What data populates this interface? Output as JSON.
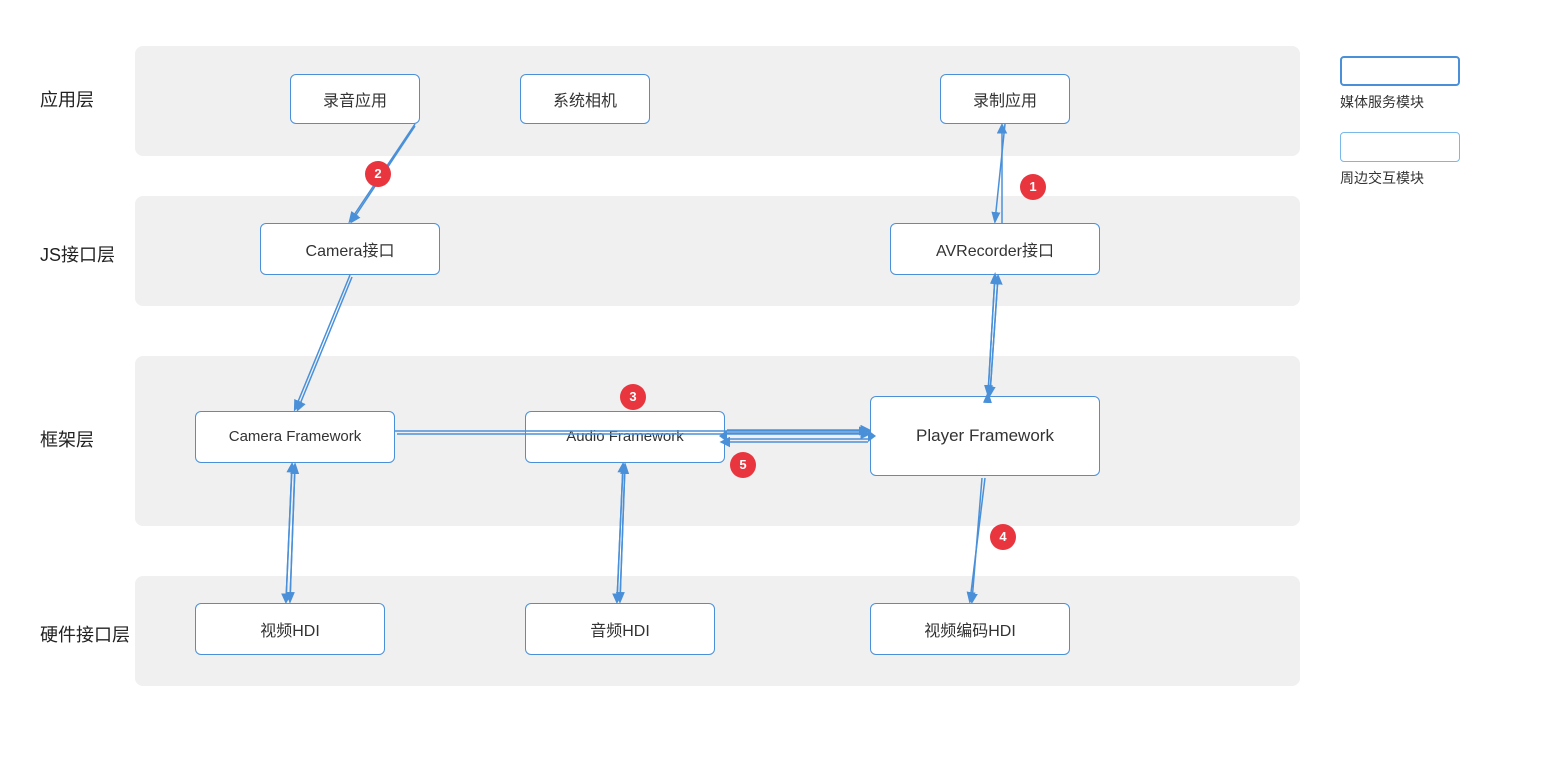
{
  "layers": {
    "app": {
      "label": "应用层",
      "nodes": [
        "录音应用",
        "系统相机",
        "录制应用"
      ]
    },
    "js": {
      "label": "JS接口层",
      "nodes": [
        "Camera接口",
        "AVRecorder接口"
      ]
    },
    "framework": {
      "label": "框架层",
      "nodes": [
        "Camera Framework",
        "Audio Framework",
        "Player Framework"
      ]
    },
    "hardware": {
      "label": "硬件接口层",
      "nodes": [
        "视频HDI",
        "音频HDI",
        "视频编码HDI"
      ]
    }
  },
  "badges": [
    "1",
    "2",
    "3",
    "4",
    "5"
  ],
  "legend": {
    "items": [
      {
        "label": "媒体服务模块",
        "type": "solid"
      },
      {
        "label": "周边交互模块",
        "type": "light"
      }
    ]
  }
}
